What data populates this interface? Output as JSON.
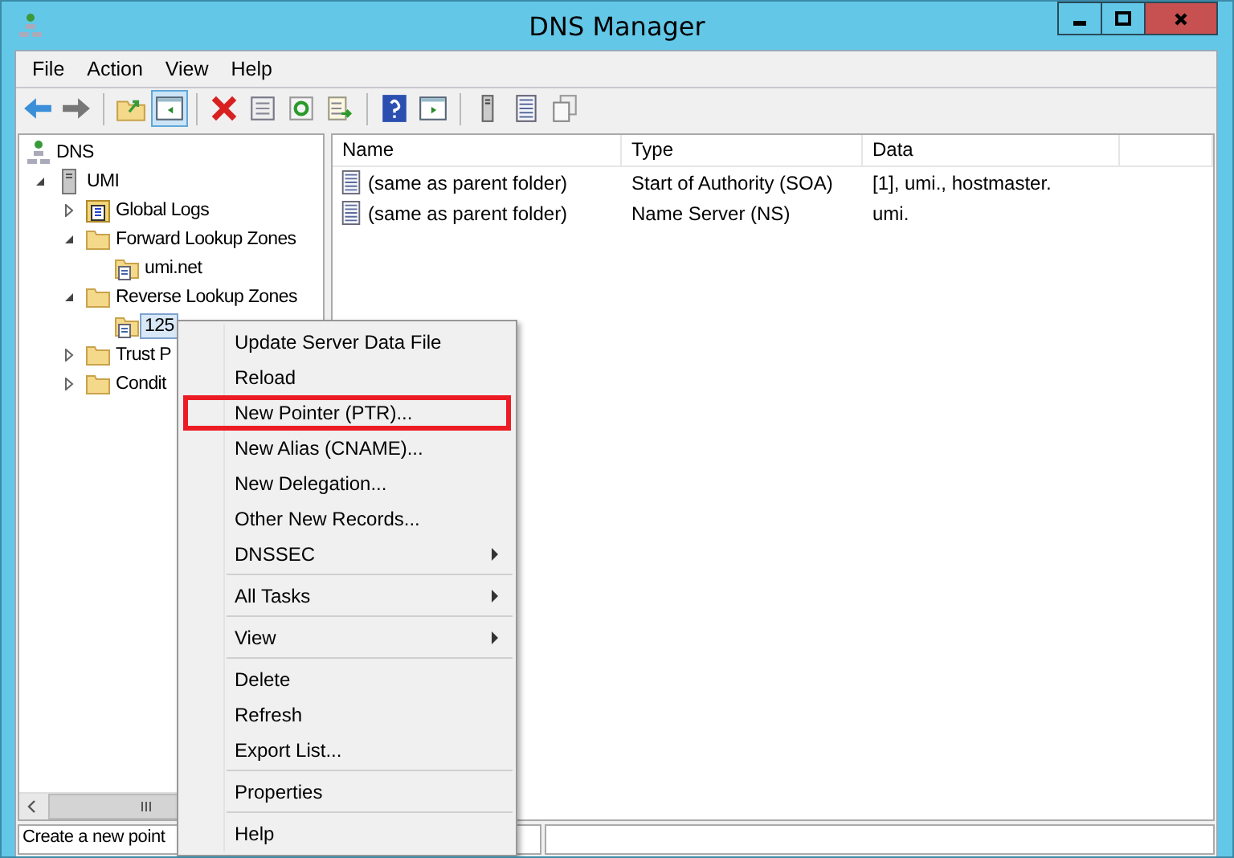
{
  "window": {
    "title": "DNS Manager"
  },
  "menu_bar": [
    "File",
    "Action",
    "View",
    "Help"
  ],
  "tree": [
    {
      "label": "DNS",
      "kind": "dns",
      "selected": false,
      "children": [
        {
          "label": "UMI",
          "kind": "server",
          "expanded": true,
          "selected": false,
          "children": [
            {
              "label": "Global Logs",
              "kind": "log",
              "expanded": false,
              "selected": false
            },
            {
              "label": "Forward Lookup Zones",
              "kind": "folder",
              "expanded": true,
              "selected": false,
              "children": [
                {
                  "label": "umi.net",
                  "kind": "zone",
                  "selected": false
                }
              ]
            },
            {
              "label": "Reverse Lookup Zones",
              "kind": "folder",
              "expanded": true,
              "selected": false,
              "children": [
                {
                  "label": "125",
                  "kind": "zone",
                  "selected": true
                }
              ]
            },
            {
              "label": "Trust P",
              "kind": "folder",
              "expanded": false,
              "selected": false
            },
            {
              "label": "Condit",
              "kind": "folder",
              "expanded": false,
              "selected": false
            }
          ]
        }
      ]
    }
  ],
  "list": {
    "columns": [
      "Name",
      "Type",
      "Data"
    ],
    "rows": [
      {
        "name": "(same as parent folder)",
        "type": "Start of Authority (SOA)",
        "data": "[1], umi., hostmaster."
      },
      {
        "name": "(same as parent folder)",
        "type": "Name Server (NS)",
        "data": "umi."
      }
    ]
  },
  "context_menu": {
    "groups": [
      [
        {
          "label": "Update Server Data File",
          "submenu": false,
          "outlined": false
        },
        {
          "label": "Reload",
          "submenu": false,
          "outlined": false
        },
        {
          "label": "New Pointer (PTR)...",
          "submenu": false,
          "outlined": true
        },
        {
          "label": "New Alias (CNAME)...",
          "submenu": false,
          "outlined": false
        },
        {
          "label": "New Delegation...",
          "submenu": false,
          "outlined": false
        },
        {
          "label": "Other New Records...",
          "submenu": false,
          "outlined": false
        },
        {
          "label": "DNSSEC",
          "submenu": true,
          "outlined": false
        }
      ],
      [
        {
          "label": "All Tasks",
          "submenu": true,
          "outlined": false
        }
      ],
      [
        {
          "label": "View",
          "submenu": true,
          "outlined": false
        }
      ],
      [
        {
          "label": "Delete",
          "submenu": false,
          "outlined": false
        },
        {
          "label": "Refresh",
          "submenu": false,
          "outlined": false
        },
        {
          "label": "Export List...",
          "submenu": false,
          "outlined": false
        }
      ],
      [
        {
          "label": "Properties",
          "submenu": false,
          "outlined": false
        }
      ],
      [
        {
          "label": "Help",
          "submenu": false,
          "outlined": false
        }
      ]
    ]
  },
  "status_bar": "Create a new point"
}
